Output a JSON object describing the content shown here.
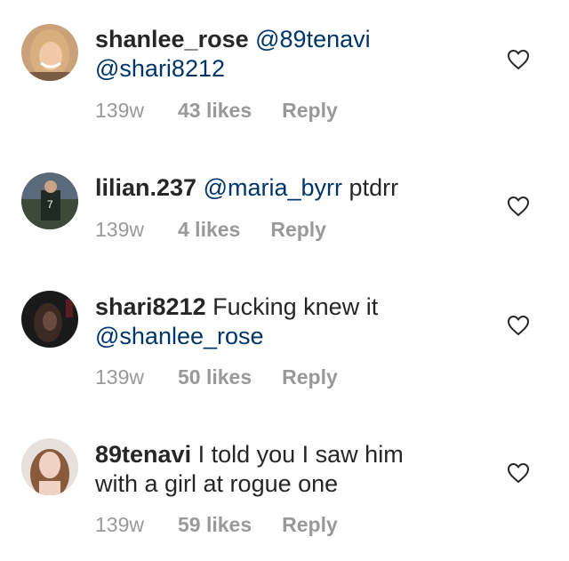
{
  "comments": [
    {
      "username": "shanlee_rose",
      "mentions": [
        "@89tenavi",
        "@shari8212"
      ],
      "text": "",
      "time": "139w",
      "likes": "43 likes",
      "reply": "Reply",
      "avatar": "avatar-shanlee-rose"
    },
    {
      "username": "lilian.237",
      "mentions": [
        "@maria_byrr"
      ],
      "text": "ptdrr",
      "time": "139w",
      "likes": "4 likes",
      "reply": "Reply",
      "avatar": "avatar-lilian"
    },
    {
      "username": "shari8212",
      "mentions": [
        "@shanlee_rose"
      ],
      "text": "Fucking knew it",
      "time": "139w",
      "likes": "50 likes",
      "reply": "Reply",
      "avatar": "avatar-shari"
    },
    {
      "username": "89tenavi",
      "mentions": [],
      "text": "I told you I saw him with a girl at rogue one",
      "time": "139w",
      "likes": "59 likes",
      "reply": "Reply",
      "avatar": "avatar-89tenavi"
    }
  ],
  "colors": {
    "mention": "#003569",
    "meta": "#999999",
    "text": "#262626"
  },
  "icons": {
    "like": "heart-outline-icon"
  }
}
